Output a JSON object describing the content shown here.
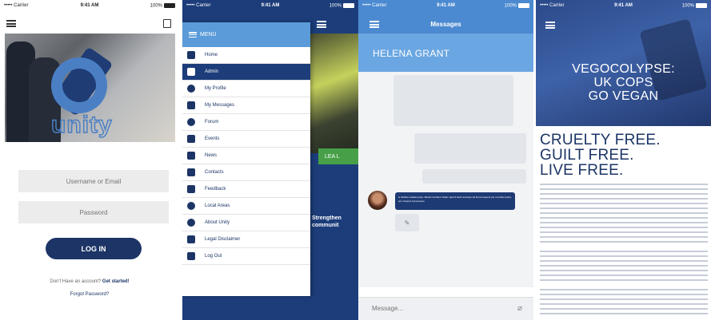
{
  "status": {
    "carrier": "••••• Carrier",
    "time": "9:41 AM",
    "battery": "100%"
  },
  "login": {
    "logo_text": "unity",
    "username_placeholder": "Username or Email",
    "password_placeholder": "Password",
    "login_label": "LOG IN",
    "no_account": "Don't Have an account?",
    "get_started": "Get started!",
    "forgot": "Forgot Password?"
  },
  "menu": {
    "header": "MENU",
    "items": [
      {
        "label": "Home",
        "icon": "grid-icon"
      },
      {
        "label": "Admin",
        "icon": "lock-icon",
        "active": true
      },
      {
        "label": "My Profile",
        "icon": "user-icon"
      },
      {
        "label": "My Messages",
        "icon": "envelope-icon"
      },
      {
        "label": "Forum",
        "icon": "chat-bubble-icon"
      },
      {
        "label": "Events",
        "icon": "calendar-icon"
      },
      {
        "label": "News",
        "icon": "newspaper-icon"
      },
      {
        "label": "Contacts",
        "icon": "contact-card-icon"
      },
      {
        "label": "Feedback",
        "icon": "edit-icon"
      },
      {
        "label": "Local Areas",
        "icon": "map-pin-icon"
      },
      {
        "label": "About Unity",
        "icon": "info-icon"
      },
      {
        "label": "Legal Disclaimer",
        "icon": "scales-icon"
      },
      {
        "label": "Log Out",
        "icon": "logout-icon"
      }
    ],
    "behind_label": "LEA L",
    "behind_text_1": "Strengthen",
    "behind_text_2": "communit"
  },
  "messages": {
    "title": "Messages",
    "contact": "HELENA GRANT",
    "incoming": "is facilisis sodales justo. Mauris tincidunt. Etiam aptent taciti sociosqu ad litora torquent per conubia nostra, per inceptos hymenaeos.",
    "input_placeholder": "Message..."
  },
  "article": {
    "headline_1": "VEGOCOLYPSE:",
    "headline_2": "UK COPS",
    "headline_3": "GO VEGAN",
    "big_1": "CRUELTY FREE.",
    "big_2": "GUILT FREE.",
    "big_3": "LIVE FREE."
  }
}
